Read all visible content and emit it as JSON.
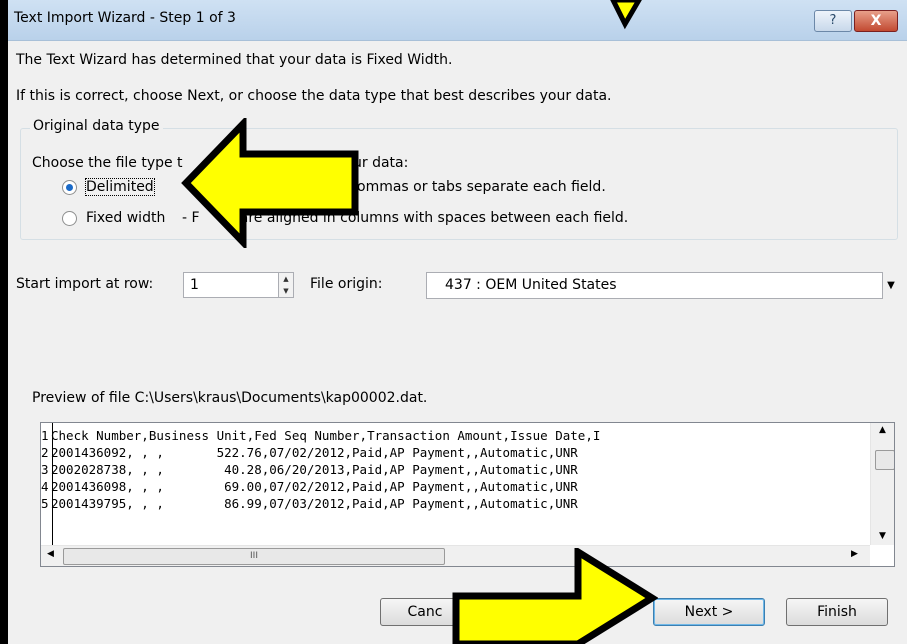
{
  "window": {
    "title": "Text Import Wizard - Step 1 of 3",
    "help_label": "?",
    "close_label": "X"
  },
  "intro": {
    "line1": "The Text Wizard has determined that your data is Fixed Width.",
    "line2": "If this is correct, choose Next, or choose the data type that best describes your data."
  },
  "original_data_type": {
    "legend": "Original data type",
    "prompt_visible_start": "Choose the file type t",
    "prompt_visible_end": "ur data:",
    "options": [
      {
        "label": "Delimited",
        "desc_visible": "ommas or tabs separate each field.",
        "selected": true
      },
      {
        "label": "Fixed width",
        "desc_visible_start": "- F",
        "desc_visible_end": "s are aligned in columns with spaces between each field.",
        "selected": false
      }
    ]
  },
  "import_settings": {
    "start_row_label": "Start import at row:",
    "start_row_value": "1",
    "file_origin_label": "File origin:",
    "file_origin_value": "437 : OEM United States"
  },
  "preview": {
    "label": "Preview of file C:\\Users\\kraus\\Documents\\kap00002.dat.",
    "rows": [
      {
        "num": "1",
        "text": "Check Number,Business Unit,Fed Seq Number,Transaction Amount,Issue Date,I"
      },
      {
        "num": "2",
        "text": "2001436092, , ,       522.76,07/02/2012,Paid,AP Payment,,Automatic,UNR"
      },
      {
        "num": "3",
        "text": "2002028738, , ,        40.28,06/20/2013,Paid,AP Payment,,Automatic,UNR"
      },
      {
        "num": "4",
        "text": "2001436098, , ,        69.00,07/02/2012,Paid,AP Payment,,Automatic,UNR"
      },
      {
        "num": "5",
        "text": "2001439795, , ,        86.99,07/03/2012,Paid,AP Payment,,Automatic,UNR"
      }
    ],
    "hscroll_thumb_mark": "III"
  },
  "buttons": {
    "cancel_visible": "Canc",
    "next": "Next >",
    "finish": "Finish"
  },
  "colors": {
    "annotation_arrow_fill": "#ffff00",
    "annotation_arrow_stroke": "#000000",
    "radio_selected": "#1a6ac8"
  }
}
